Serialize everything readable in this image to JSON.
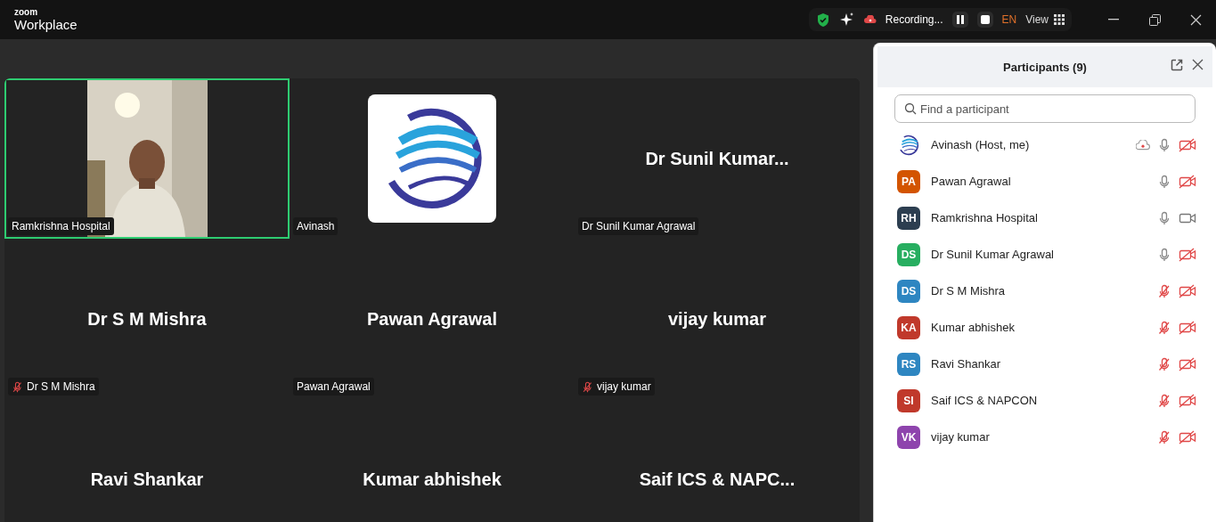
{
  "app": {
    "brand_small": "zoom",
    "brand": "Workplace"
  },
  "toolbar": {
    "recording": "Recording...",
    "language": "EN",
    "view": "View"
  },
  "gallery": [
    {
      "kind": "video",
      "label": "Ramkrishna Hospital",
      "muted": false,
      "speaking": true
    },
    {
      "kind": "logo",
      "label": "Avinash",
      "muted": false,
      "speaking": false
    },
    {
      "kind": "name",
      "name": "Dr Sunil Kumar...",
      "label": "Dr Sunil Kumar Agrawal",
      "muted": false,
      "speaking": false
    },
    {
      "kind": "name",
      "name": "Dr S M Mishra",
      "label": "Dr S M Mishra",
      "muted": true,
      "speaking": false
    },
    {
      "kind": "name",
      "name": "Pawan Agrawal",
      "label": "Pawan Agrawal",
      "muted": false,
      "speaking": false
    },
    {
      "kind": "name",
      "name": "vijay kumar",
      "label": "vijay kumar",
      "muted": true,
      "speaking": false
    },
    {
      "kind": "name",
      "name": "Ravi Shankar",
      "speaking": false
    },
    {
      "kind": "name",
      "name": "Kumar abhishek",
      "speaking": false
    },
    {
      "kind": "name",
      "name": "Saif ICS & NAPC...",
      "speaking": false
    }
  ],
  "participants_panel": {
    "title": "Participants (9)",
    "search": {
      "placeholder": "Find a participant"
    },
    "participants": [
      {
        "kind": "logo",
        "name": "Avinash (Host, me)",
        "recording": true,
        "mic_muted": false,
        "video_on": false
      },
      {
        "kind": "initials",
        "initials": "PA",
        "color": "#d35400",
        "name": "Pawan Agrawal",
        "recording": false,
        "mic_muted": false,
        "video_on": false
      },
      {
        "kind": "initials",
        "initials": "RH",
        "color": "#2c3e50",
        "name": "Ramkrishna Hospital",
        "recording": false,
        "mic_muted": false,
        "video_on": true
      },
      {
        "kind": "initials",
        "initials": "DS",
        "color": "#27ae60",
        "name": "Dr Sunil Kumar Agrawal",
        "recording": false,
        "mic_muted": false,
        "video_on": false
      },
      {
        "kind": "initials",
        "initials": "DS",
        "color": "#2e86c1",
        "name": "Dr S M Mishra",
        "recording": false,
        "mic_muted": true,
        "video_on": false
      },
      {
        "kind": "initials",
        "initials": "KA",
        "color": "#c0392b",
        "name": "Kumar abhishek",
        "recording": false,
        "mic_muted": true,
        "video_on": false
      },
      {
        "kind": "initials",
        "initials": "RS",
        "color": "#2e86c1",
        "name": "Ravi Shankar",
        "recording": false,
        "mic_muted": true,
        "video_on": false
      },
      {
        "kind": "initials",
        "initials": "SI",
        "color": "#c0392b",
        "name": "Saif ICS & NAPCON",
        "recording": false,
        "mic_muted": true,
        "video_on": false
      },
      {
        "kind": "initials",
        "initials": "VK",
        "color": "#8e44ad",
        "name": "vijay kumar",
        "recording": false,
        "mic_muted": true,
        "video_on": false
      }
    ]
  }
}
